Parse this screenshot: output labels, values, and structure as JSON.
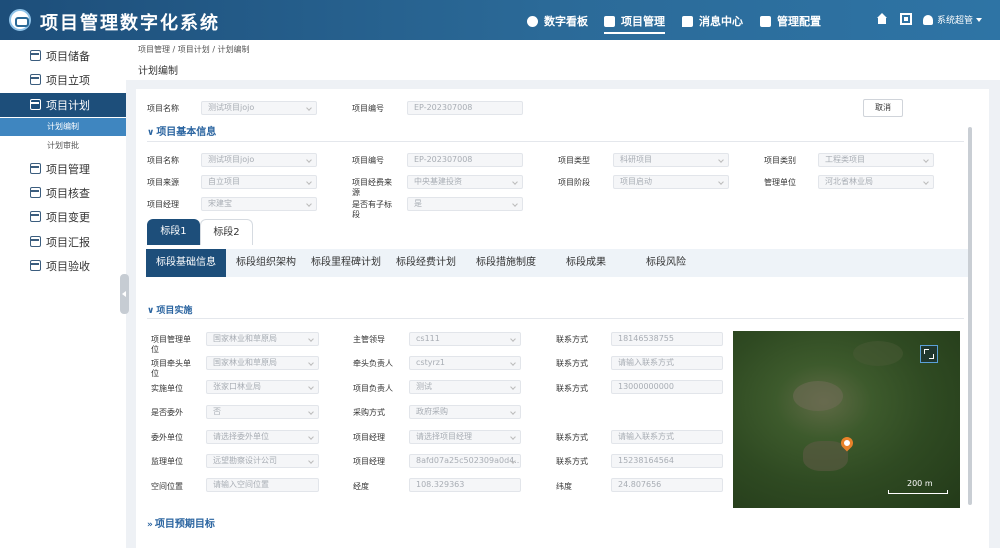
{
  "app": {
    "title": "项目管理数字化系统"
  },
  "topnav": [
    {
      "label": "数字看板",
      "icon": "pie-chart-icon"
    },
    {
      "label": "项目管理",
      "icon": "folder-icon",
      "active": true
    },
    {
      "label": "消息中心",
      "icon": "message-icon"
    },
    {
      "label": "管理配置",
      "icon": "settings-folder-icon"
    }
  ],
  "user": {
    "name": "系统超管"
  },
  "sidebar": {
    "items": [
      {
        "label": "项目储备"
      },
      {
        "label": "项目立项"
      },
      {
        "label": "项目计划",
        "active": true
      },
      {
        "label": "项目管理"
      },
      {
        "label": "项目核查"
      },
      {
        "label": "项目变更"
      },
      {
        "label": "项目汇报"
      },
      {
        "label": "项目验收"
      }
    ],
    "subitems": [
      {
        "label": "计划编制",
        "active": true
      },
      {
        "label": "计划审批"
      }
    ]
  },
  "breadcrumb": "项目管理 / 项目计划 / 计划编制",
  "page_title": "计划编制",
  "top_form": {
    "name_label": "项目名称",
    "name_value": "测试项目jojo",
    "code_label": "项目编号",
    "code_value": "EP-202307008",
    "cancel": "取消"
  },
  "basic_section": {
    "title": "项目基本信息",
    "fields": [
      {
        "label": "项目名称",
        "value": "测试项目jojo"
      },
      {
        "label": "项目编号",
        "value": "EP-202307008"
      },
      {
        "label": "项目类型",
        "value": "科研项目"
      },
      {
        "label": "项目类别",
        "value": "工程类项目"
      },
      {
        "label": "项目来源",
        "value": "自立项目"
      },
      {
        "label": "项目经费来源",
        "value": "中央基建投资"
      },
      {
        "label": "项目阶段",
        "value": "项目启动"
      },
      {
        "label": "管理单位",
        "value": "河北省林业局"
      },
      {
        "label": "项目经理",
        "value": "宋建宝"
      },
      {
        "label": "是否有子标段",
        "value": "是"
      }
    ]
  },
  "segment_tabs": [
    "标段1",
    "标段2"
  ],
  "sub_tabs": [
    "标段基础信息",
    "标段组织架构",
    "标段里程碑计划",
    "标段经费计划",
    "标段措施制度",
    "标段成果",
    "标段风险"
  ],
  "impl_section": {
    "title": "项目实施",
    "col1": [
      {
        "label": "项目管理单位",
        "value": "国家林业和草原局"
      },
      {
        "label": "项目牵头单位",
        "value": "国家林业和草原局"
      },
      {
        "label": "实施单位",
        "value": "张家口林业局"
      },
      {
        "label": "是否委外",
        "value": "否"
      },
      {
        "label": "委外单位",
        "value": "请选择委外单位"
      },
      {
        "label": "监理单位",
        "value": "远望勘察设计公司"
      },
      {
        "label": "空间位置",
        "value": "请输入空间位置"
      }
    ],
    "col2": [
      {
        "label": "主管领导",
        "value": "cs111"
      },
      {
        "label": "牵头负责人",
        "value": "cstyrz1"
      },
      {
        "label": "项目负责人",
        "value": "测试"
      },
      {
        "label": "采购方式",
        "value": "政府采购"
      },
      {
        "label": "项目经理",
        "value": "请选择项目经理"
      },
      {
        "label": "项目经理",
        "value": "8afd07a25c502309a0d4..."
      },
      {
        "label": "经度",
        "value": "108.329363"
      }
    ],
    "col3": [
      {
        "label": "联系方式",
        "value": "18146538755"
      },
      {
        "label": "联系方式",
        "value": "请输入联系方式"
      },
      {
        "label": "联系方式",
        "value": "13000000000"
      },
      {
        "label": "",
        "value": ""
      },
      {
        "label": "联系方式",
        "value": "请输入联系方式"
      },
      {
        "label": "联系方式",
        "value": "15238164564"
      },
      {
        "label": "纬度",
        "value": "24.807656"
      }
    ]
  },
  "map": {
    "scale": "200 m"
  },
  "goal_section": {
    "title": "项目预期目标"
  },
  "colors": {
    "primary": "#1d4e7a",
    "accent": "#2a64a0",
    "active_sub": "#3f86c0"
  }
}
